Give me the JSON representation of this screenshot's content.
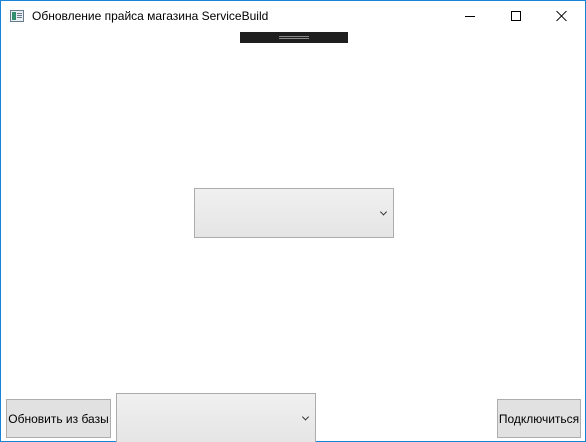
{
  "window": {
    "title": "Обновление прайса магазина ServiceBuild",
    "icon": "app-window-icon",
    "controls": [
      "minimize-icon",
      "maximize-icon",
      "close-icon"
    ]
  },
  "main_combo": {
    "value": "",
    "icon": "chevron-down-icon"
  },
  "bottom_combo": {
    "value": "",
    "icon": "chevron-down-icon"
  },
  "buttons": {
    "refresh_label": "Обновить из базы",
    "connect_label": "Подключиться"
  },
  "colors": {
    "window_border": "#1883d7",
    "button_bg": "#e1e1e1",
    "button_border": "#adadad",
    "combo_border": "#acacac"
  }
}
